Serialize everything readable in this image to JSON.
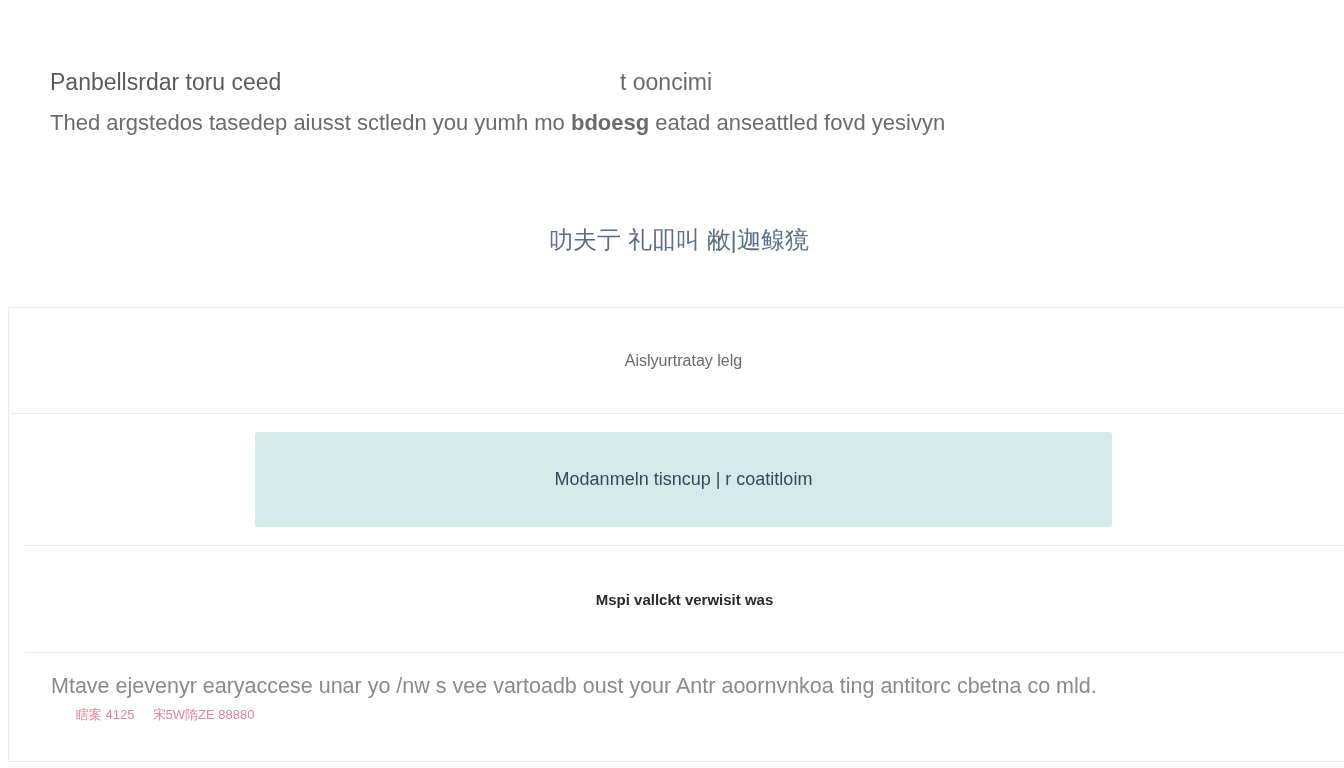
{
  "header": {
    "title": "Panbellsrdar toru ceed",
    "title_aside": "t ooncimi",
    "subtitle": "Thed argstedos tasedep aiusst sctledn you yumh mo **bdoesg** eatad anseattled fovd yesivyn"
  },
  "section_heading": "叻夫亍 礼吅叫 敝|迦鳈獍",
  "panel": {
    "caption": "Aislyurtratay lelg",
    "highlight": "Modanmeln tisncup | r coatitloim",
    "label": "Mspi vallckt verwisit was",
    "note": "Mtave ejevenyr earyaccese unar yo /nw s vee vartoadb oust your Antr aoornvnkoa ting antitorc cbetna co mld.",
    "meta": [
      "瞎案 4125",
      "宋5W隋ZE 88880"
    ]
  }
}
